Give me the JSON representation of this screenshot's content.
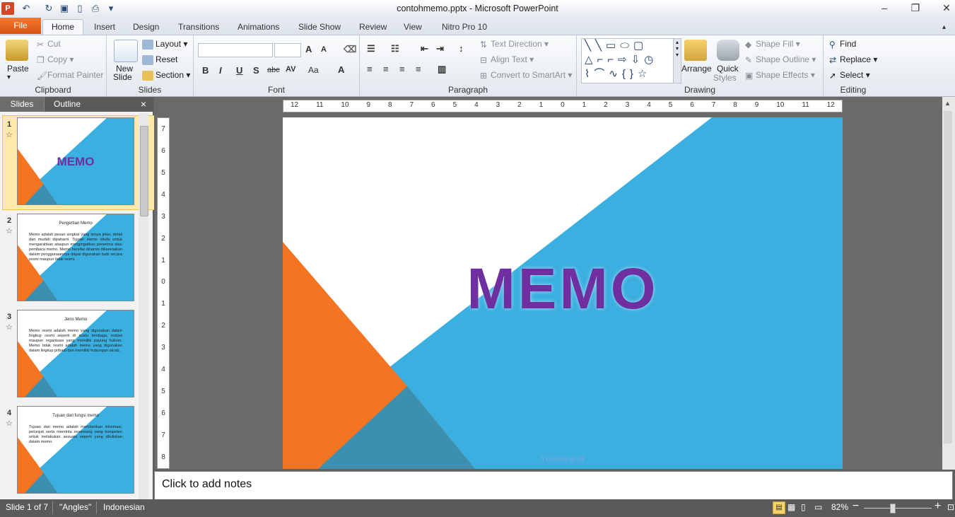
{
  "window": {
    "title": "contohmemo.pptx - Microsoft PowerPoint",
    "minimize": "–",
    "restore": "❐",
    "close": "✕"
  },
  "tabs": {
    "file": "File",
    "items": [
      "Home",
      "Insert",
      "Design",
      "Transitions",
      "Animations",
      "Slide Show",
      "Review",
      "View",
      "Nitro Pro 10"
    ]
  },
  "ribbon": {
    "clipboard": {
      "label": "Clipboard",
      "paste": "Paste",
      "cut": "Cut",
      "copy": "Copy",
      "format_painter": "Format Painter"
    },
    "slides": {
      "label": "Slides",
      "new_slide_1": "New",
      "new_slide_2": "Slide",
      "layout": "Layout",
      "reset": "Reset",
      "section": "Section"
    },
    "font": {
      "label": "Font",
      "bold": "B",
      "italic": "I",
      "underline": "U",
      "shadow": "S",
      "strike": "abc",
      "spacing": "AV",
      "case": "Aa",
      "color": "A",
      "grow": "A",
      "shrink": "A"
    },
    "paragraph": {
      "label": "Paragraph",
      "text_direction": "Text Direction",
      "align_text": "Align Text",
      "smartart": "Convert to SmartArt"
    },
    "drawing": {
      "label": "Drawing",
      "arrange": "Arrange",
      "quick_styles_1": "Quick",
      "quick_styles_2": "Styles",
      "shape_fill": "Shape Fill",
      "shape_outline": "Shape Outline",
      "shape_effects": "Shape Effects"
    },
    "editing": {
      "label": "Editing",
      "find": "Find",
      "replace": "Replace",
      "select": "Select"
    }
  },
  "pane": {
    "tab_slides": "Slides",
    "tab_outline": "Outline",
    "close": "×",
    "thumbnails": [
      {
        "num": "1",
        "title": "MEMO"
      },
      {
        "num": "2",
        "title": "Pengertian Memo",
        "body": "Memo adalah pesan singkat yang isinya jelas, detail dan mudah dipahami. Tujuan memo ditulis untuk mengarahkan ataupun mengingatkan penerima atau pembaca memo. Memo bersifat dinamis dikarenakan dalam penggunaannya dapat digunakan baik secara resmi maupun tidak resmi."
      },
      {
        "num": "3",
        "title": "Jenis Memo",
        "body": "Memo resmi adalah memo yang digunakan dalam lingkup resmi seperti di suatu lembaga, instasi maupun organisasi yang memiliki payung hukum. Memo tidak resmi adalah memo yang digunakan dalam lingkup pribadi dan memiliki hubungan akrab."
      },
      {
        "num": "4",
        "title": "Tujuan dari fungsi memo",
        "body": "Tujuan dari memo adalah memberikan informasi, petunjuk serta meminta seseorang yang kompeten untuk melakukan sesuatu seperti yang dituliskan dalam memo."
      }
    ]
  },
  "rulers": {
    "h_ticks": [
      "12",
      "11",
      "10",
      "9",
      "8",
      "7",
      "6",
      "5",
      "4",
      "3",
      "2",
      "1",
      "0",
      "1",
      "2",
      "3",
      "4",
      "5",
      "6",
      "7",
      "8",
      "9",
      "10",
      "11",
      "12"
    ],
    "v_ticks": [
      "7",
      "6",
      "5",
      "4",
      "3",
      "2",
      "1",
      "0",
      "1",
      "2",
      "3",
      "4",
      "5",
      "6",
      "7",
      "8"
    ]
  },
  "slide": {
    "title": "MEMO",
    "subtitle": "Yuliawanti",
    "colors": {
      "blue": "#3aafe0",
      "orange": "#f47421",
      "overlap": "#3d8fb0",
      "title": "#6f2fa0"
    }
  },
  "notes": {
    "placeholder": "Click to add notes"
  },
  "status": {
    "slide": "Slide 1 of 7",
    "theme": "\"Angles\"",
    "language": "Indonesian",
    "zoom": "82%",
    "zoom_minus": "−",
    "zoom_plus": "+"
  }
}
